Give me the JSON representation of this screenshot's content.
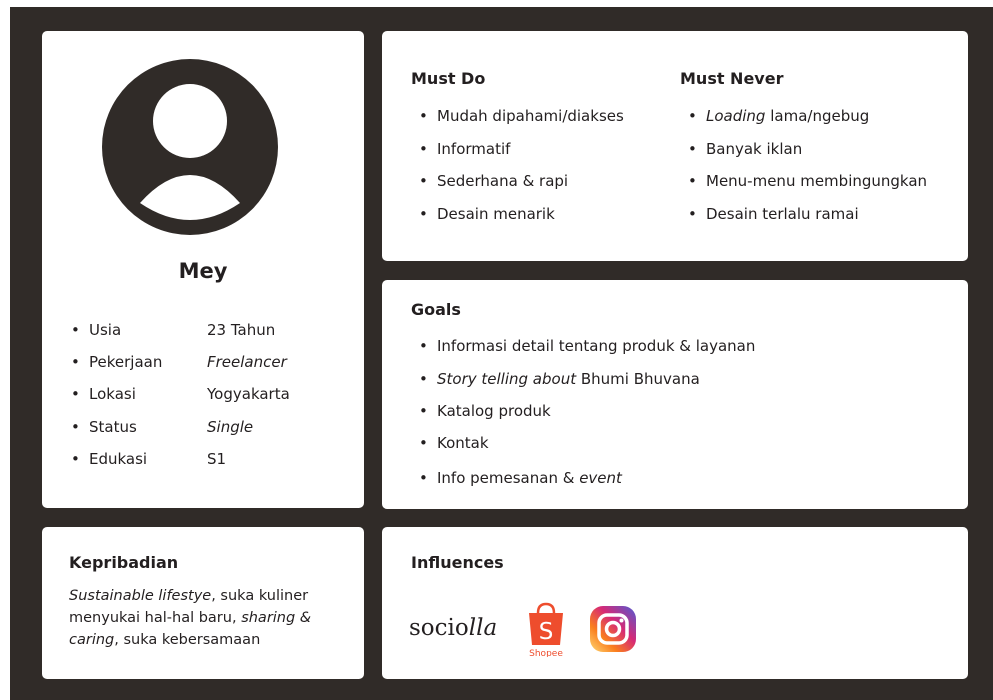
{
  "profile": {
    "name": "Mey",
    "attributes": [
      {
        "label": "Usia",
        "value": "23 Tahun"
      },
      {
        "label": "Pekerjaan",
        "value": "Freelancer"
      },
      {
        "label": "Lokasi",
        "value": "Yogyakarta"
      },
      {
        "label": "Status",
        "value": "Single"
      },
      {
        "label": "Edukasi",
        "value": "S1"
      }
    ]
  },
  "must_do": {
    "title": "Must Do",
    "items": [
      "Mudah dipahami/diakses",
      "Informatif",
      "Sederhana & rapi",
      "Desain menarik"
    ]
  },
  "must_never": {
    "title": "Must Never",
    "items": [
      {
        "italic": "Loading",
        "rest": " lama/ngebug"
      },
      "Banyak iklan",
      "Menu-menu membingungkan",
      "Desain terlalu ramai"
    ]
  },
  "goals": {
    "title": "Goals",
    "items": [
      "Informasi detail tentang produk & layanan",
      {
        "italic": "Story telling about",
        "rest": " Bhumi Bhuvana"
      },
      "Katalog produk",
      "Kontak",
      {
        "before": "Info pemesanan & ",
        "italic": "event"
      }
    ]
  },
  "kepribadian": {
    "title": "Kepribadian",
    "line1_italic": "Sustainable lifestye",
    "line1_rest": ", suka kuliner",
    "line2_before": "menyukai hal-hal baru, ",
    "line2_italic": "sharing &",
    "line3_italic": "caring",
    "line3_rest": ", suka kebersamaan"
  },
  "influences": {
    "title": "Influences",
    "logos": [
      {
        "name": "sociolla",
        "text_plain": "socio",
        "text_italic": "lla"
      },
      {
        "name": "shopee",
        "letter": "S",
        "caption": "Shopee",
        "color": "#ee4d2d"
      },
      {
        "name": "instagram",
        "icon": "instagram-icon"
      }
    ]
  }
}
